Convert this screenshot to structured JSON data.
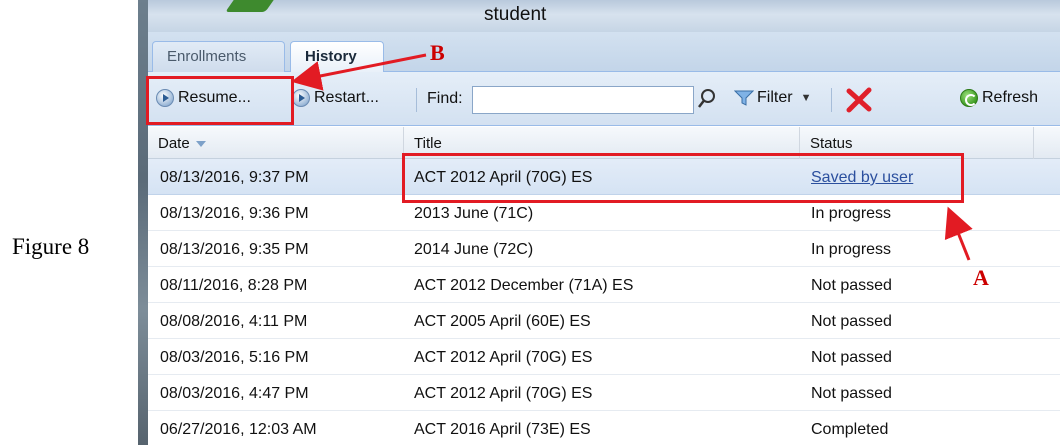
{
  "figure_label": "Figure 8",
  "window": {
    "title": "student"
  },
  "tabs": [
    {
      "label": "Enrollments",
      "active": false
    },
    {
      "label": "History",
      "active": true
    }
  ],
  "toolbar": {
    "resume_label": "Resume...",
    "restart_label": "Restart...",
    "find_label": "Find:",
    "find_value": "",
    "filter_label": "Filter",
    "refresh_label": "Refresh"
  },
  "table": {
    "columns": [
      "Date",
      "Title",
      "Status"
    ],
    "sorted_column": "Date",
    "rows": [
      {
        "date": "08/13/2016, 9:37 PM",
        "title": "ACT 2012 April (70G) ES",
        "status": "Saved by user",
        "selected": true
      },
      {
        "date": "08/13/2016, 9:36 PM",
        "title": "2013 June (71C)",
        "status": "In progress"
      },
      {
        "date": "08/13/2016, 9:35 PM",
        "title": "2014 June (72C)",
        "status": "In progress"
      },
      {
        "date": "08/11/2016, 8:28 PM",
        "title": "ACT 2012 December (71A) ES",
        "status": "Not passed"
      },
      {
        "date": "08/08/2016, 4:11 PM",
        "title": "ACT 2005 April (60E) ES",
        "status": "Not passed"
      },
      {
        "date": "08/03/2016, 5:16 PM",
        "title": "ACT 2012 April (70G) ES",
        "status": "Not passed"
      },
      {
        "date": "08/03/2016, 4:47 PM",
        "title": "ACT 2012 April (70G) ES",
        "status": "Not passed"
      },
      {
        "date": "06/27/2016, 12:03 AM",
        "title": "ACT 2016 April (73E) ES",
        "status": "Completed"
      }
    ]
  },
  "annotations": {
    "label_a": "A",
    "label_b": "B",
    "color": "#e21b23"
  },
  "icons": {
    "resume": "play-circle-icon",
    "restart": "play-circle-icon",
    "find": "magnifier-icon",
    "filter": "funnel-icon",
    "delete": "red-x-icon",
    "refresh": "refresh-circle-icon"
  }
}
